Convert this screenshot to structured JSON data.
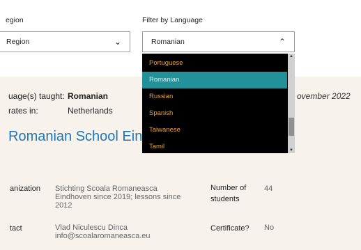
{
  "filters": {
    "region_label": "egion",
    "region_value": "Region",
    "language_label": "Filter by Language",
    "language_value": "Romanian"
  },
  "dropdown": {
    "options": [
      "Portuguese",
      "Romanian",
      "Russian",
      "Spanish",
      "Taiwanese",
      "Tamil"
    ],
    "selected": "Romanian"
  },
  "card": {
    "lang_label": "uage(s) taught:",
    "lang_value": "Romanian",
    "operates_label": "rates in:",
    "operates_value": "Netherlands",
    "date": "ovember 2022",
    "school_name": "Romanian School Ein",
    "organization_label": "anization",
    "organization_value": [
      "Stichting Scoala Romaneasca",
      "Eindhoven since 2019; lessons since",
      "2012"
    ],
    "students_label": [
      "Number of",
      "students"
    ],
    "students_value": "44",
    "contact_label": "tact",
    "contact_value": [
      "Vlad Niculescu Dinca",
      "info@scoalaromaneasca.eu"
    ],
    "certificate_label": "Certificate?",
    "certificate_value": "No"
  },
  "colors": {
    "accent_blue": "#1d77b5",
    "selected_option": "#22919a",
    "option_text": "#e0a347"
  },
  "icons": {
    "region_chevron": "chevron-down-icon",
    "language_chevron": "chevron-up-icon"
  }
}
